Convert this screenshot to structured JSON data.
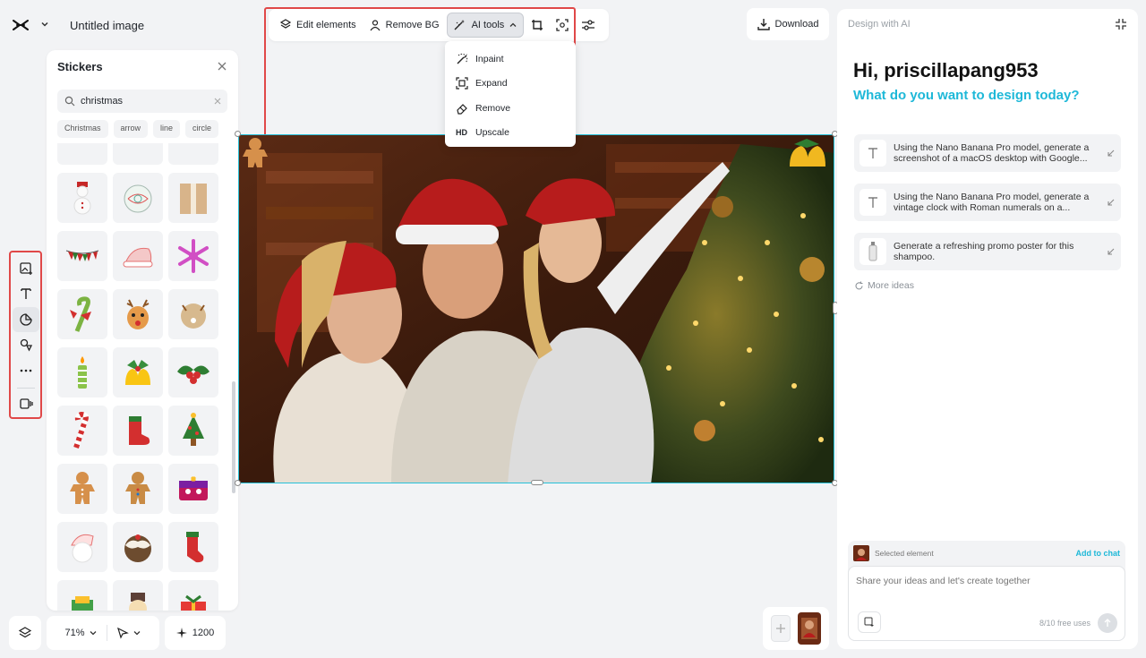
{
  "app": {
    "title": "Untitled image"
  },
  "stickers": {
    "title": "Stickers",
    "search_value": "christmas",
    "chips": [
      "Christmas",
      "arrow",
      "line",
      "circle"
    ]
  },
  "toolbar": {
    "edit_elements": "Edit elements",
    "remove_bg": "Remove BG",
    "ai_tools": "AI tools"
  },
  "ai_menu": {
    "items": [
      "Inpaint",
      "Expand",
      "Remove",
      "Upscale"
    ],
    "hd_badge": "HD"
  },
  "download_label": "Download",
  "bottom": {
    "zoom": "71%",
    "size": "1200"
  },
  "ai_panel": {
    "header": "Design with AI",
    "greeting": "Hi, priscillapang953",
    "question": "What do you want to design today?",
    "ideas": [
      "Using the Nano Banana Pro model, generate a screenshot of a macOS desktop with Google...",
      "Using the Nano Banana Pro model, generate a vintage clock with Roman numerals on a...",
      "Generate a refreshing promo poster for this shampoo."
    ],
    "more_ideas": "More ideas",
    "selected_element": "Selected element",
    "add_to_chat": "Add to chat",
    "chat_placeholder": "Share your ideas and let's create together",
    "free_uses": "8/10 free uses"
  },
  "colors": {
    "accent": "#1eb8d8",
    "highlight": "#e04848",
    "selection": "#27c1d9"
  }
}
